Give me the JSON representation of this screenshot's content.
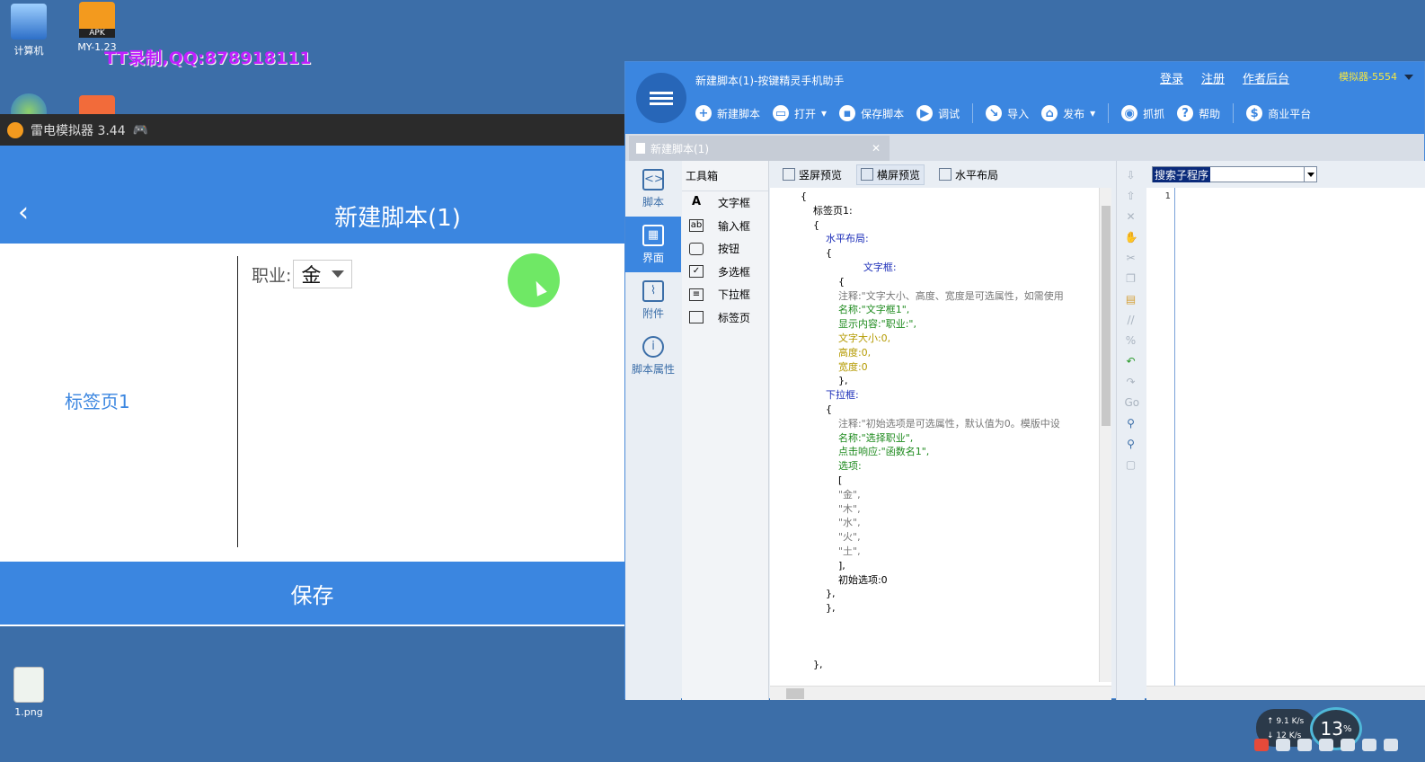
{
  "desktop": {
    "icons": [
      {
        "label": "计算机"
      },
      {
        "label": "MY-1.23"
      },
      {
        "label": "1.png"
      }
    ],
    "apk_badge": "APK",
    "watermark": "TT录制,QQ:878918111"
  },
  "emulator": {
    "window_title": "雷电模拟器 3.44",
    "screen_title": "新建脚本(1)",
    "tab_label": "标签页1",
    "job_label": "职业:",
    "job_value": "金",
    "save_button": "保存"
  },
  "editor": {
    "title": "新建脚本(1)-按键精灵手机助手",
    "links": [
      "登录",
      "注册",
      "作者后台"
    ],
    "device": "模拟器-5554",
    "toolbar": {
      "new": "新建脚本",
      "open": "打开",
      "save": "保存脚本",
      "debug": "调试",
      "import": "导入",
      "publish": "发布",
      "grab": "抓抓",
      "help": "帮助",
      "market": "商业平台"
    },
    "doc_tab": "新建脚本(1)",
    "nav": [
      "脚本",
      "界面",
      "附件",
      "脚本属性"
    ],
    "toolbox_title": "工具箱",
    "tools": [
      "文字框",
      "输入框",
      "按钮",
      "多选框",
      "下拉框",
      "标签页"
    ],
    "code_bar": [
      "竖屏预览",
      "横屏预览",
      "水平布局"
    ],
    "code_lines": [
      "{",
      "    标签页1:",
      "    {",
      "        水平布局:",
      "        {",
      "                    文字框:",
      "            {",
      "            注释:\"文字大小、高度、宽度是可选属性，如需使用",
      "            名称:\"文字框1\",",
      "            显示内容:\"职业:\",",
      "            文字大小:0,",
      "            高度:0,",
      "            宽度:0",
      "            },",
      "        下拉框:",
      "        {",
      "            注释:\"初始选项是可选属性，默认值为0。模版中设",
      "            名称:\"选择职业\",",
      "            点击响应:\"函数名1\",",
      "            选项:",
      "            [",
      "            \"金\",",
      "            \"木\",",
      "            \"水\",",
      "            \"火\",",
      "            \"土\",",
      "            ],",
      "            初始选项:0",
      "        },",
      "        },",
      "",
      "",
      "",
      "    },"
    ],
    "subroutine_search": "搜索子程序",
    "line_number": "1"
  },
  "taskbar": {
    "net_up": "9.1",
    "net_down": "12",
    "net_unit": "K/s",
    "cpu": "13",
    "cpu_unit": "%"
  }
}
